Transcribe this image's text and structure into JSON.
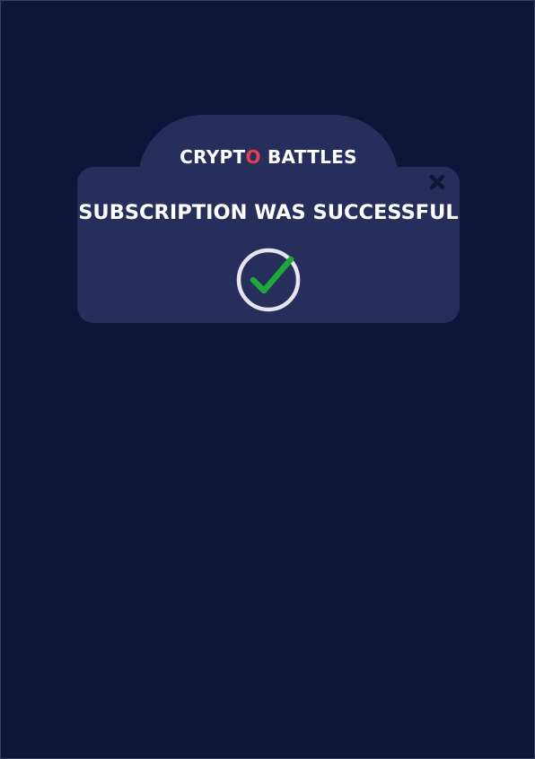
{
  "modal": {
    "brand": {
      "part1": "CRYPT",
      "accent_letter": "O",
      "part2": " BATTLES"
    },
    "title": "SUBSCRIPTION WAS SUCCESSFUL",
    "close_icon": "close-icon",
    "status_icon": "check-circle-icon"
  },
  "colors": {
    "background": "#0e1539",
    "panel": "#262f5b",
    "accent": "#e0404f",
    "check": "#1ea83a",
    "close": "#0f1638"
  }
}
